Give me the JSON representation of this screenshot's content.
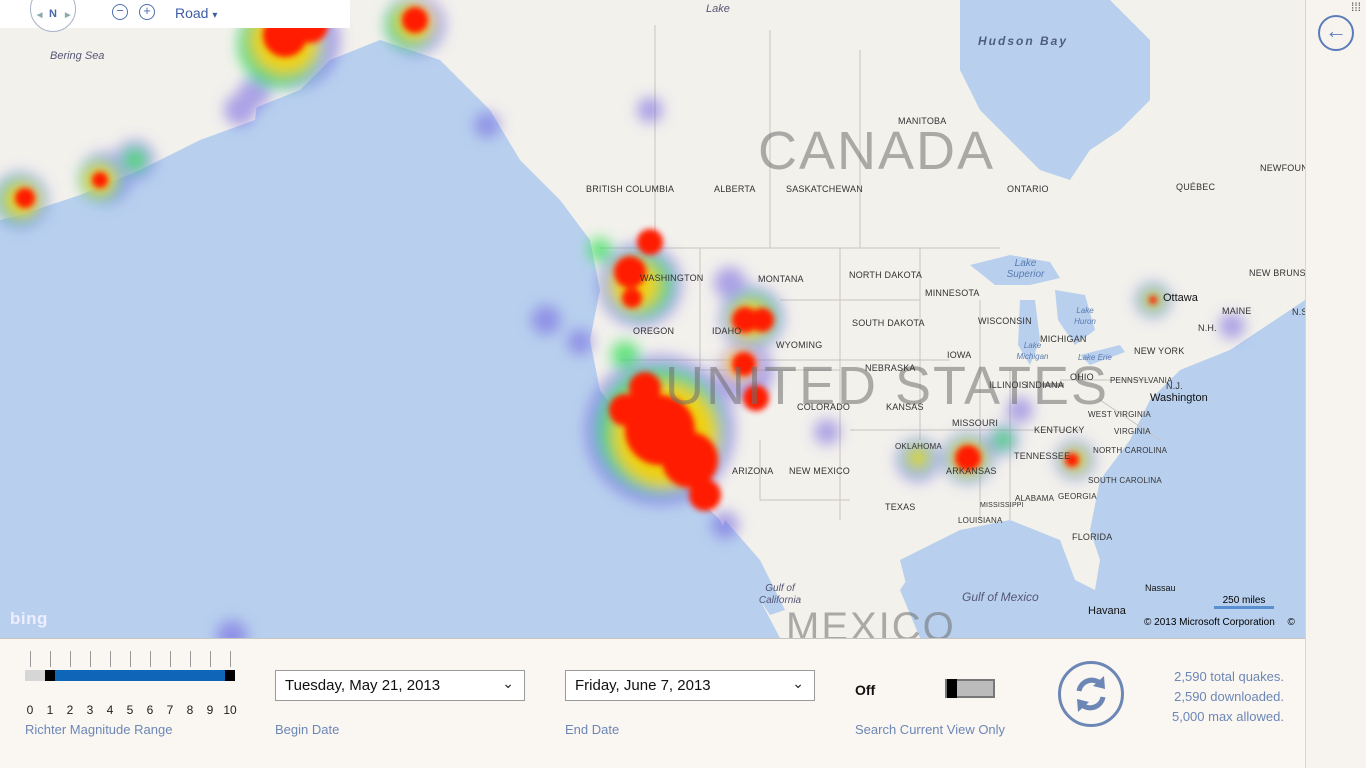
{
  "map": {
    "nav": {
      "compass_label": "N",
      "zoom_out": "−",
      "zoom_in": "+",
      "map_type": "Road",
      "map_type_caret": "▾"
    },
    "country_labels": [
      "CANADA",
      "UNITED STATES",
      "MEXICO"
    ],
    "water_labels": [
      "Bering Sea",
      "Hudson Bay",
      "Gulf of California",
      "Gulf of Mexico",
      "Lake"
    ],
    "lake_labels": [
      "Lake Superior",
      "Lake Huron",
      "Lake Michigan",
      "Lake Erie"
    ],
    "region_labels": [
      "BRITISH COLUMBIA",
      "ALBERTA",
      "SASKATCHEWAN",
      "MANITOBA",
      "ONTARIO",
      "QUÉBEC",
      "NEWFOUNDLAND",
      "NEW BRUNSWICK",
      "N.S.",
      "MONTANA",
      "NORTH DAKOTA",
      "MINNESOTA",
      "SOUTH DAKOTA",
      "WISCONSIN",
      "MICHIGAN",
      "IDAHO",
      "OREGON",
      "WASHINGTON",
      "WYOMING",
      "NEBRASKA",
      "IOWA",
      "ILLINOIS",
      "INDIANA",
      "OHIO",
      "PENNSYLVANIA",
      "NEW YORK",
      "N.H.",
      "MAINE",
      "N.J.",
      "COLORADO",
      "KANSAS",
      "MISSOURI",
      "KENTUCKY",
      "WEST VIRGINIA",
      "VIRGINIA",
      "TENNESSEE",
      "NORTH CAROLINA",
      "SOUTH CAROLINA",
      "ARIZONA",
      "NEW MEXICO",
      "OKLAHOMA",
      "ARKANSAS",
      "TEXAS",
      "LOUISIANA",
      "MISSISSIPPI",
      "ALABAMA",
      "GEORGIA",
      "FLORIDA"
    ],
    "city_labels": [
      "Ottawa",
      "Washington",
      "Nassau",
      "Havana"
    ],
    "branding": "bing",
    "copyright": "© 2013 Microsoft Corporation",
    "copyright_suffix": "©",
    "scale": "250 miles",
    "heat_colors": {
      "hot": "#ff1a00",
      "warm": "#ffd000",
      "mid": "#40e060",
      "cool": "#7060e0"
    }
  },
  "sidebar": {
    "back_icon": "←",
    "app_grid_icon": "⁞⁞⁞"
  },
  "controls": {
    "richter": {
      "label": "Richter Magnitude Range",
      "ticks": [
        "0",
        "1",
        "2",
        "3",
        "4",
        "5",
        "6",
        "7",
        "8",
        "9",
        "10"
      ],
      "range_min": 1,
      "range_max": 10,
      "range_color": "#0f65b8"
    },
    "begin_date": {
      "value": "Tuesday, May 21, 2013",
      "label": "Begin Date",
      "chevron": "⌄"
    },
    "end_date": {
      "value": "Friday, June 7, 2013",
      "label": "End Date",
      "chevron": "⌄"
    },
    "search_view": {
      "state": "Off",
      "label": "Search Current View Only"
    },
    "refresh_icon": "⟳",
    "stats": [
      "2,590 total quakes.",
      "2,590 downloaded.",
      "5,000 max allowed."
    ]
  }
}
